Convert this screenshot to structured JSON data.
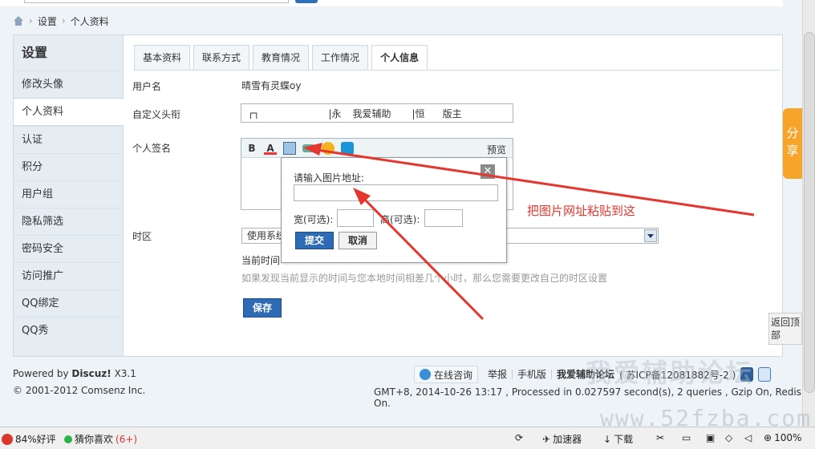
{
  "breadcrumb": {
    "settings": "设置",
    "current": "个人资料"
  },
  "sidebar": {
    "title": "设置",
    "items": [
      {
        "label": "修改头像"
      },
      {
        "label": "个人资料"
      },
      {
        "label": "认证"
      },
      {
        "label": "积分"
      },
      {
        "label": "用户组"
      },
      {
        "label": "隐私筛选"
      },
      {
        "label": "密码安全"
      },
      {
        "label": "访问推广"
      },
      {
        "label": "QQ绑定"
      },
      {
        "label": "QQ秀"
      }
    ]
  },
  "tabs": [
    "基本资料",
    "联系方式",
    "教育情况",
    "工作情况",
    "个人信息"
  ],
  "form": {
    "username_label": "用户名",
    "username_value": "晴雪有灵蝶oy",
    "customtitle_label": "自定义头衔",
    "customtitle_parts": [
      "┌┐",
      "|永",
      "我爱辅助",
      "|恒",
      "版主"
    ],
    "signature_label": "个人签名",
    "toolbar": {
      "bold": "B",
      "color": "A",
      "preview": "预览"
    },
    "timezone_label": "时区",
    "timezone_value": "使用系统",
    "current_time_label": "当前时间",
    "hint": "如果发现当前显示的时间与您本地时间相差几个小时，那么您需要更改自己的时区设置",
    "save": "保存"
  },
  "popup": {
    "url_label": "请输入图片地址:",
    "width_label": "宽(可选):",
    "height_label": "高(可选):",
    "submit": "提交",
    "cancel": "取消",
    "close": "✕"
  },
  "annotation": "把图片网址粘贴到这",
  "side": {
    "share": "分享",
    "backtop": "返回顶部"
  },
  "footer": {
    "powered": "Powered by",
    "product": "Discuz!",
    "version": "X3.1",
    "copyright": "© 2001-2012 Comsenz Inc.",
    "online": "在线咨询",
    "report": "举报",
    "mobile": "手机版",
    "site": "我爱辅助论坛",
    "icp": "( 苏ICP备12081882号-2 )",
    "stats": "GMT+8, 2014-10-26 13:17 , Processed in 0.027597 second(s), 2 queries , Gzip On, Redis On."
  },
  "watermark": {
    "cn": "我爱辅助论坛",
    "url": "www.52fzba.com"
  },
  "statusbar": {
    "rating": "84%好评",
    "guess": "猜你喜欢",
    "guess_count": "(6+)",
    "accel": "加速器",
    "download": "下载",
    "zoom": "100%"
  },
  "colors": {
    "accent_blue": "#2d6bb4",
    "annotation_red": "#e3372f",
    "share_orange": "#f7a52a"
  }
}
